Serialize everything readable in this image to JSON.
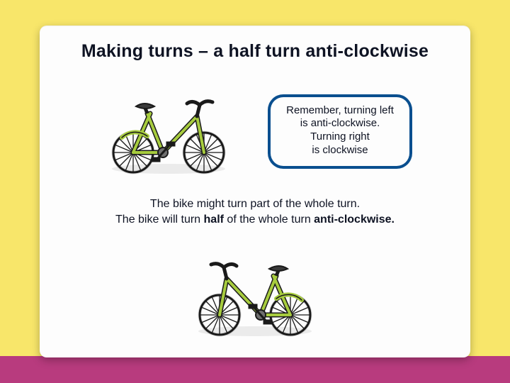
{
  "title": "Making turns – a half turn anti-clockwise",
  "callout": {
    "line1": "Remember, turning left",
    "line2": "is anti-clockwise.",
    "line3": "Turning right",
    "line4": "is clockwise"
  },
  "body": {
    "line1": "The bike might turn part of the whole turn.",
    "line2_a": "The bike will turn ",
    "line2_b": "half",
    "line2_c": " of the whole turn ",
    "line2_d": "anti-clockwise.",
    "line2_e": ""
  },
  "icons": {
    "bike_top": "bike-icon",
    "bike_bottom": "bike-icon"
  },
  "colors": {
    "background": "#f8e66a",
    "stripe": "#b83b7e",
    "callout_border": "#0a4f8f",
    "card": "#fdfdfd",
    "bike_frame": "#a7cc3e",
    "bike_outline": "#1a1a1a",
    "bike_seat": "#3a3a3a"
  }
}
